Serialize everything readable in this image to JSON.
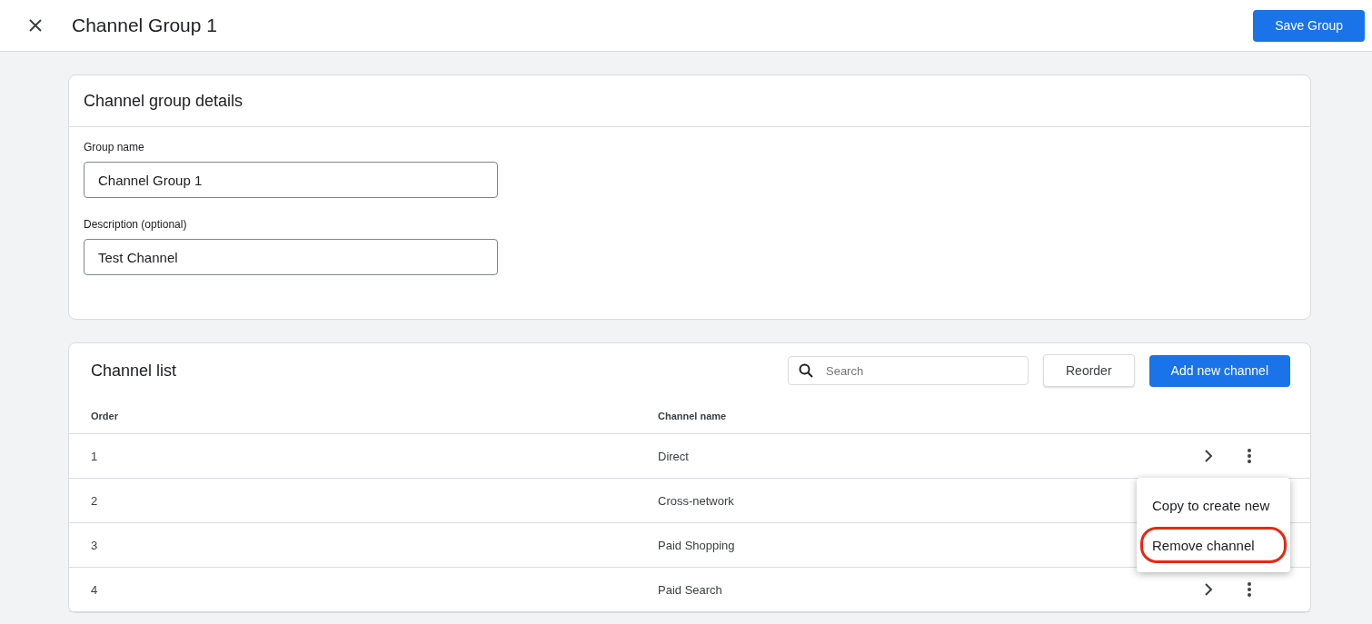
{
  "header": {
    "title": "Channel Group 1",
    "save_button": "Save Group"
  },
  "details": {
    "title": "Channel group details",
    "fields": [
      {
        "label": "Group name",
        "value": "Channel Group 1"
      },
      {
        "label": "Description (optional)",
        "value": "Test Channel"
      }
    ]
  },
  "channel_list": {
    "title": "Channel list",
    "search": {
      "placeholder": "Search"
    },
    "reorder_button": "Reorder",
    "add_button": "Add new channel",
    "columns": [
      "Order",
      "Channel name"
    ],
    "rows": [
      {
        "order": "1",
        "name": "Direct",
        "menu": [
          {
            "label": "Copy to create new",
            "highlighted": false
          },
          {
            "label": "Remove channel",
            "highlighted": true
          }
        ]
      },
      {
        "order": "2",
        "name": "Cross-network"
      },
      {
        "order": "3",
        "name": "Paid Shopping"
      },
      {
        "order": "4",
        "name": "Paid Search"
      }
    ]
  }
}
